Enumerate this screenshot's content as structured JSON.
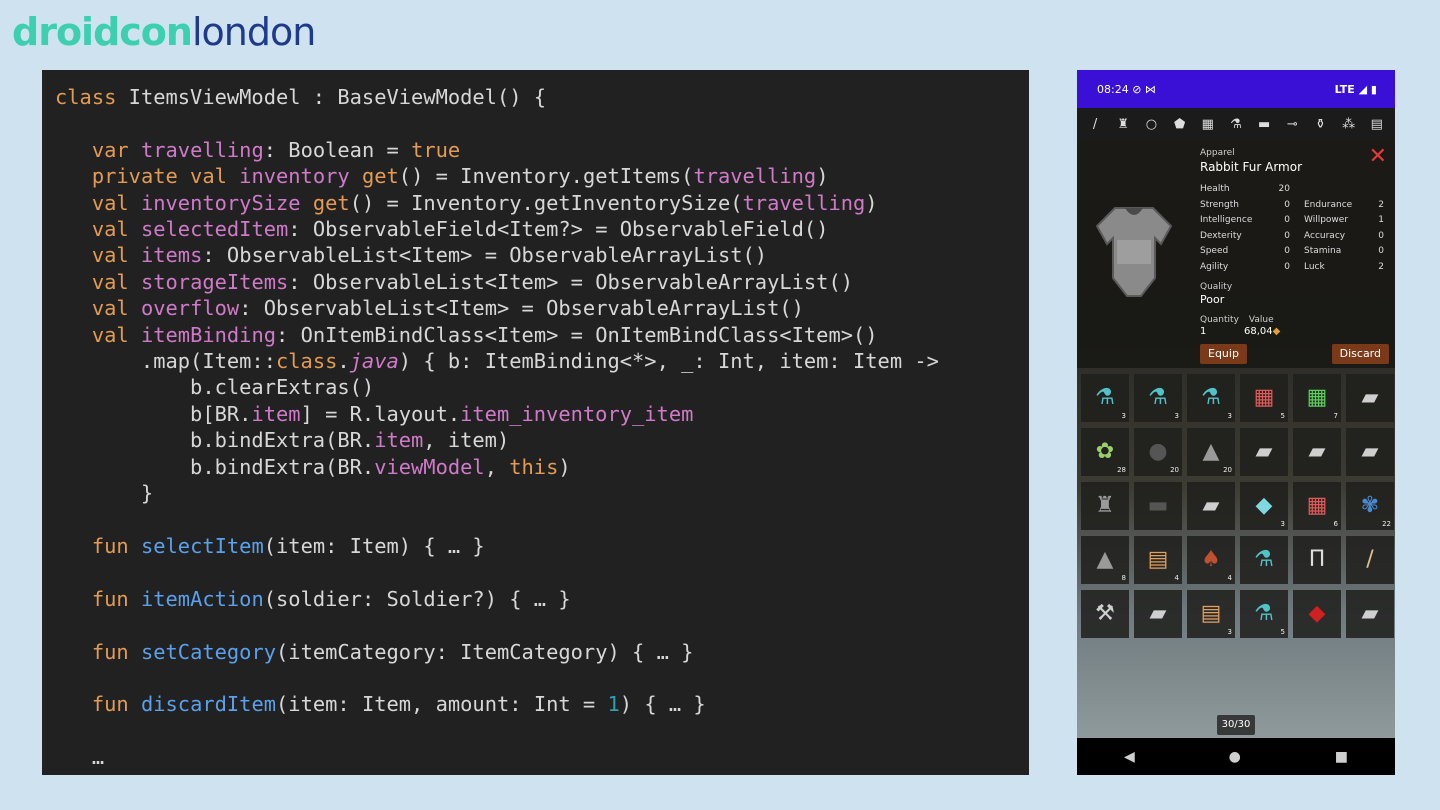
{
  "logo": {
    "part1": "droidcon",
    "part2": "london"
  },
  "phone": {
    "status": {
      "time": "08:24",
      "icons_left": "⊘ ⋈",
      "right": "LTE ◢ ▮"
    },
    "categories": [
      {
        "icon": "sword-icon",
        "glyph": "/"
      },
      {
        "icon": "armor-icon",
        "glyph": "♜"
      },
      {
        "icon": "ring-icon",
        "glyph": "○"
      },
      {
        "icon": "pentagon-icon",
        "glyph": "⬟"
      },
      {
        "icon": "dice-icon",
        "glyph": "▦"
      },
      {
        "icon": "potion-icon",
        "glyph": "⚗"
      },
      {
        "icon": "meat-icon",
        "glyph": "▬"
      },
      {
        "icon": "bone-icon",
        "glyph": "⊸"
      },
      {
        "icon": "flask-icon",
        "glyph": "⚱"
      },
      {
        "icon": "ore-icon",
        "glyph": "⁂"
      },
      {
        "icon": "book-icon",
        "glyph": "▤"
      }
    ],
    "detail": {
      "category": "Apparel",
      "name": "Rabbit Fur Armor",
      "close": "✕",
      "stats": [
        {
          "name": "Health",
          "value": "20"
        },
        {
          "name": "Strength",
          "value": "0",
          "name2": "Endurance",
          "value2": "2"
        },
        {
          "name": "Intelligence",
          "value": "0",
          "name2": "Willpower",
          "value2": "1"
        },
        {
          "name": "Dexterity",
          "value": "0",
          "name2": "Accuracy",
          "value2": "0"
        },
        {
          "name": "Speed",
          "value": "0",
          "name2": "Stamina",
          "value2": "0"
        },
        {
          "name": "Agility",
          "value": "0",
          "name2": "Luck",
          "value2": "2"
        }
      ],
      "quality_label": "Quality",
      "quality": "Poor",
      "quantity_label": "Quantity",
      "value_label": "Value",
      "quantity": "1",
      "value": "68,04",
      "equip": "Equip",
      "discard": "Discard"
    },
    "items": [
      {
        "icon": "potion-icon",
        "glyph": "⚗",
        "count": "3",
        "color": "#4fc3c7"
      },
      {
        "icon": "potion-icon",
        "glyph": "⚗",
        "count": "3",
        "color": "#4fc3c7"
      },
      {
        "icon": "potion-icon",
        "glyph": "⚗",
        "count": "3",
        "color": "#4fc3c7"
      },
      {
        "icon": "dice-icon",
        "glyph": "▦",
        "count": "5",
        "color": "#e05a5a"
      },
      {
        "icon": "dice-icon",
        "glyph": "▦",
        "count": "7",
        "color": "#5ad05a"
      },
      {
        "icon": "ingot-icon",
        "glyph": "▰",
        "count": "",
        "color": "#cfcfcf"
      },
      {
        "icon": "herb-icon",
        "glyph": "✿",
        "count": "28",
        "color": "#9ad06a"
      },
      {
        "icon": "stone-icon",
        "glyph": "●",
        "count": "20",
        "color": "#555555"
      },
      {
        "icon": "rock-icon",
        "glyph": "▲",
        "count": "20",
        "color": "#9a9a9a"
      },
      {
        "icon": "ingot-icon",
        "glyph": "▰",
        "count": "",
        "color": "#cfcfcf"
      },
      {
        "icon": "ingot-icon",
        "glyph": "▰",
        "count": "",
        "color": "#cfcfcf"
      },
      {
        "icon": "ingot-icon",
        "glyph": "▰",
        "count": "",
        "color": "#cfcfcf"
      },
      {
        "icon": "armor-icon",
        "glyph": "♜",
        "count": "",
        "color": "#9a9a9a"
      },
      {
        "icon": "plate-icon",
        "glyph": "▬",
        "count": "",
        "color": "#555555"
      },
      {
        "icon": "ingot-icon",
        "glyph": "▰",
        "count": "",
        "color": "#cfcfcf"
      },
      {
        "icon": "diamond-icon",
        "glyph": "◆",
        "count": "3",
        "color": "#7fd8e0"
      },
      {
        "icon": "dice-icon",
        "glyph": "▦",
        "count": "6",
        "color": "#e05a5a"
      },
      {
        "icon": "herb-icon",
        "glyph": "✾",
        "count": "22",
        "color": "#4a8ad0"
      },
      {
        "icon": "rock-icon",
        "glyph": "▲",
        "count": "8",
        "color": "#9a9a9a"
      },
      {
        "icon": "book-icon",
        "glyph": "▤",
        "count": "4",
        "color": "#e0a060"
      },
      {
        "icon": "mushroom-icon",
        "glyph": "♠",
        "count": "4",
        "color": "#c05030"
      },
      {
        "icon": "potion-icon",
        "glyph": "⚗",
        "count": "",
        "color": "#4fc3c7"
      },
      {
        "icon": "pants-icon",
        "glyph": "Π",
        "count": "",
        "color": "#dddddd"
      },
      {
        "icon": "dagger-icon",
        "glyph": "/",
        "count": "",
        "color": "#e0c090"
      },
      {
        "icon": "axe-icon",
        "glyph": "⚒",
        "count": "",
        "color": "#cfcfcf"
      },
      {
        "icon": "ingot-icon",
        "glyph": "▰",
        "count": "",
        "color": "#cfcfcf"
      },
      {
        "icon": "book-icon",
        "glyph": "▤",
        "count": "3",
        "color": "#e0a060"
      },
      {
        "icon": "potion-icon",
        "glyph": "⚗",
        "count": "5",
        "color": "#4fc3c7"
      },
      {
        "icon": "ruby-icon",
        "glyph": "◆",
        "count": "",
        "color": "#d02020"
      },
      {
        "icon": "ingot-icon",
        "glyph": "▰",
        "count": "",
        "color": "#cfcfcf"
      }
    ],
    "counter": "30/30",
    "nav": {
      "back": "◀",
      "home": "●",
      "recents": "■"
    }
  }
}
